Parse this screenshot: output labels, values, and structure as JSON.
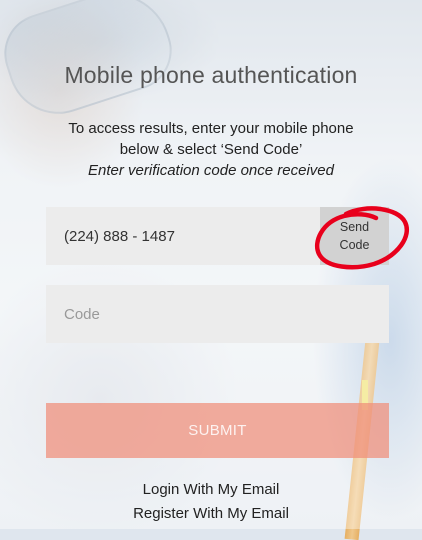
{
  "auth": {
    "title": "Mobile phone authentication",
    "instructions_line1": "To access results, enter your mobile phone",
    "instructions_line2": "below & select ‘Send Code’",
    "instructions_italic": "Enter verification code once received",
    "phone_value": "(224) 888 - 1487",
    "send_button_line1": "Send",
    "send_button_line2": "Code",
    "code_placeholder": "Code",
    "submit_label": "SUBMIT",
    "login_link": "Login With My Email",
    "register_link": "Register With My Email"
  },
  "colors": {
    "submit_bg": "#f08e78",
    "annotation_red": "#e8001c"
  }
}
